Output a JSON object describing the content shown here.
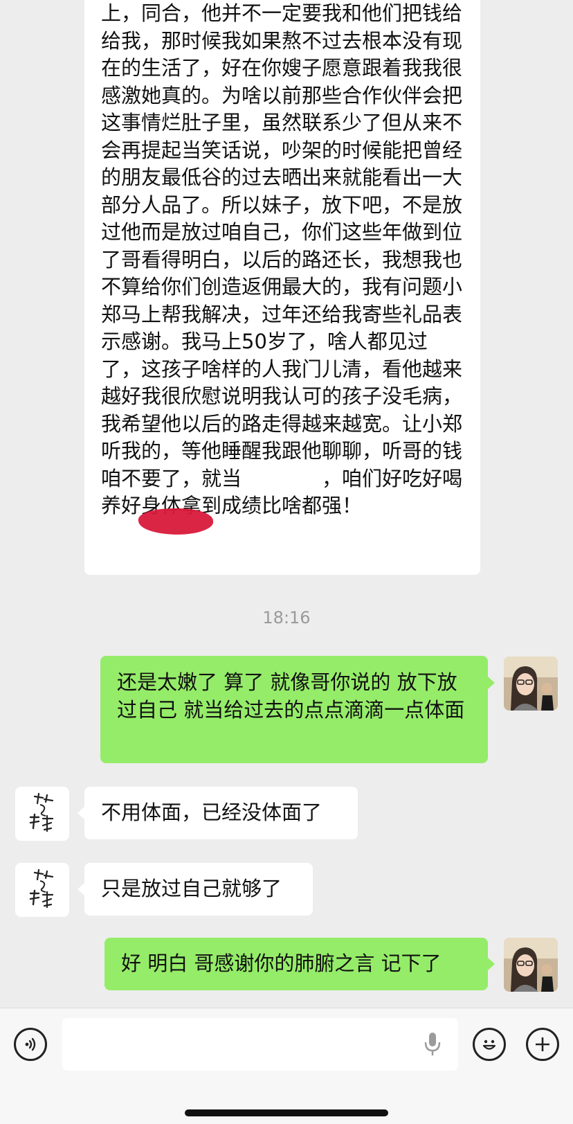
{
  "messages": {
    "long_message": "上，同合，他并不一定要我和他们把钱给给我，那时候我如果熬不过去根本没有现在的生活了，好在你嫂子愿意跟着我我很感激她真的。为啥以前那些合作伙伴会把这事情烂肚子里，虽然联系少了但从来不会再提起当笑话说，吵架的时候能把曾经的朋友最低谷的过去晒出来就能看出一大部分人品了。所以妹子，放下吧，不是放过他而是放过咱自己，你们这些年做到位了哥看得明白，以后的路还长，我想我也不算给你们创造返佣最大的，我有问题小郑马上帮我解决，过年还给我寄些礼品表示感谢。我马上50岁了，啥人都见过了，这孩子啥样的人我门儿清，看他越来越好我很欣慰说明我认可的孩子没毛病，我希望他以后的路走得越来越宽。让小郑听我的，等他睡醒我跟他聊聊，听哥的钱咱不要了，就当　　　　，咱们好吃好喝养好身体拿到成绩比啥都强！",
    "timestamp": "18:16",
    "reply_1": "还是太嫩了 算了 就像哥你说的 放下放过自己 就当给过去的点点滴滴一点体面",
    "msg_2": "不用体面，已经没体面了",
    "msg_3": "只是放过自己就够了",
    "reply_2": "好 明白 哥感谢你的肺腑之言 记下了"
  },
  "avatars": {
    "contact_logo_text": "芳尽甘来",
    "self_photo": "user-photo"
  },
  "input_bar": {
    "icons": [
      "voice-icon",
      "microphone-icon",
      "emoji-icon",
      "add-icon"
    ]
  },
  "colors": {
    "background": "#ededed",
    "sent_bubble": "#95ec69",
    "received_bubble": "#ffffff",
    "timestamp": "#9a9a9a",
    "redaction": "#d9193a"
  }
}
